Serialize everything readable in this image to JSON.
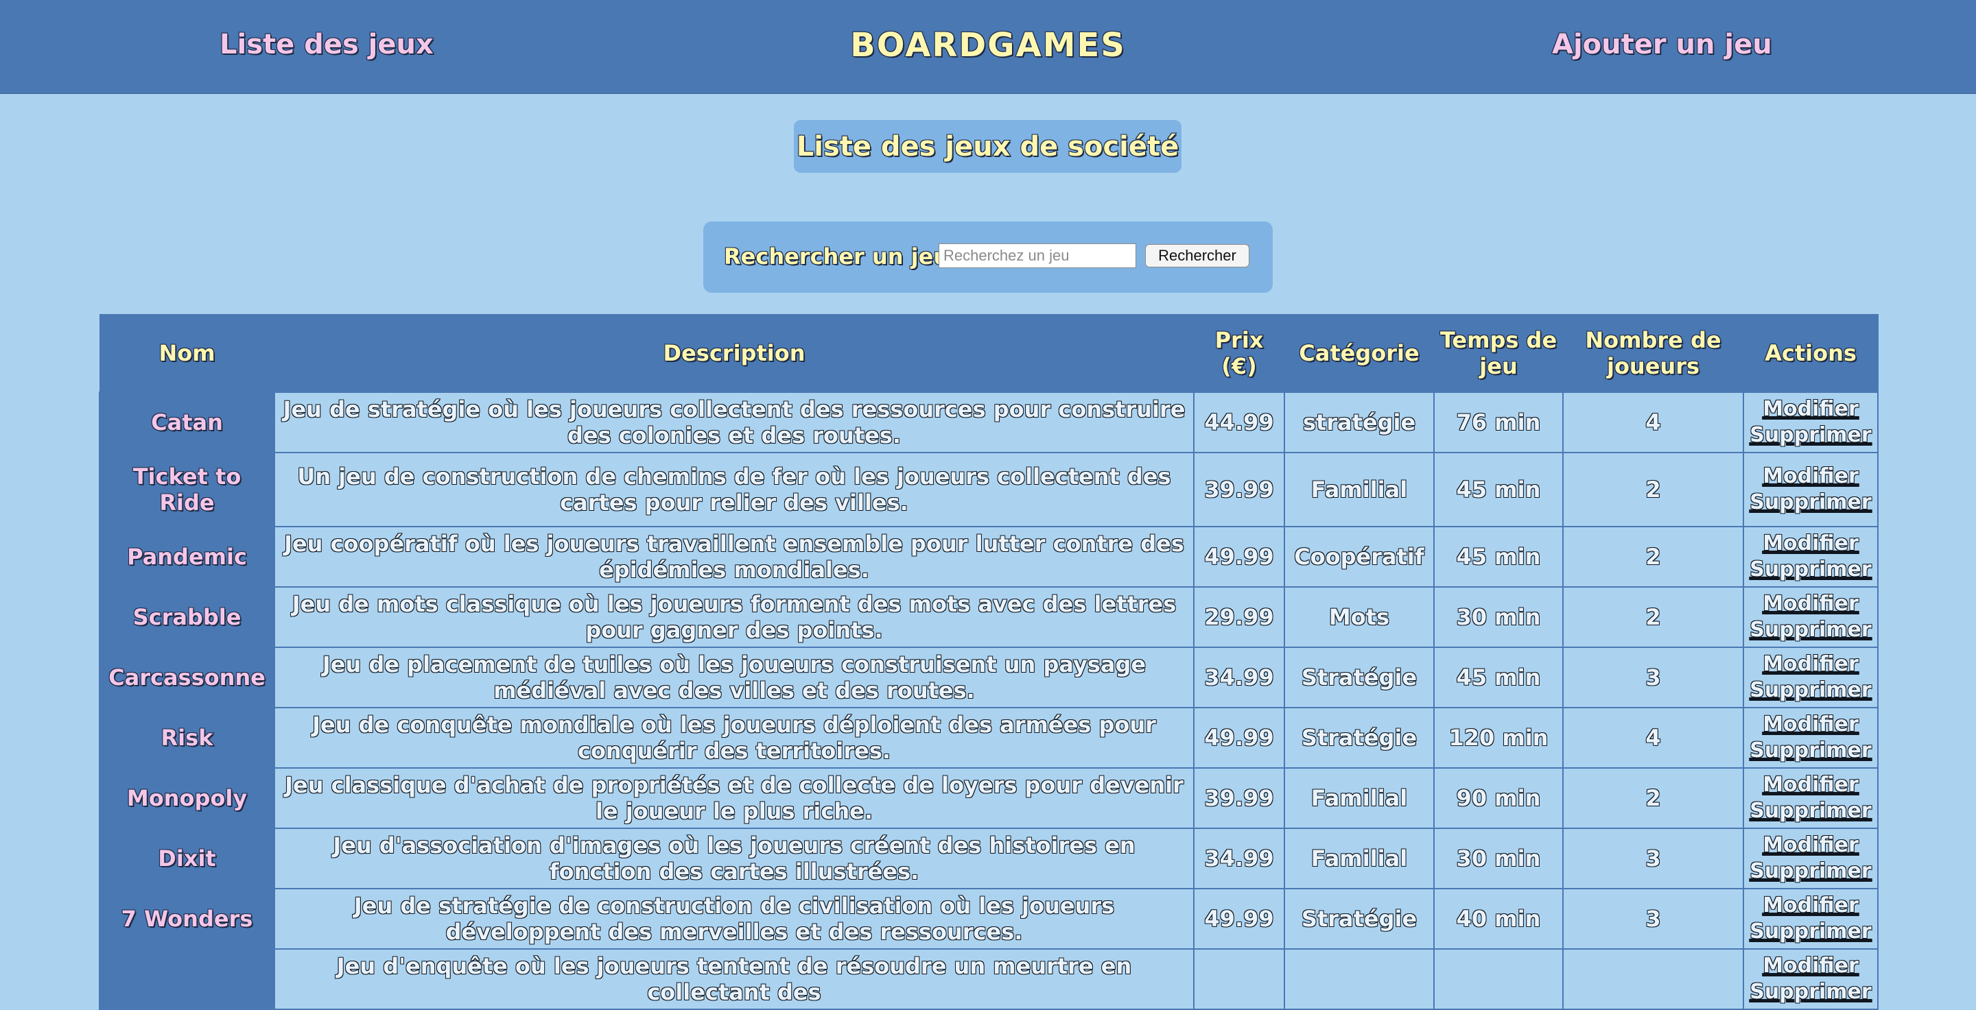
{
  "header": {
    "nav_list_label": "Liste des jeux",
    "brand": "BOARDGAMES",
    "nav_add_label": "Ajouter un jeu"
  },
  "page_title": "Liste des jeux de société",
  "search": {
    "label": "Rechercher un jeu",
    "placeholder": "Recherchez un jeu",
    "button_label": "Rechercher"
  },
  "table": {
    "headers": [
      "Nom",
      "Description",
      "Prix (€)",
      "Catégorie",
      "Temps de jeu",
      "Nombre de joueurs",
      "Actions"
    ],
    "edit_label": "Modifier",
    "delete_label": "Supprimer",
    "rows": [
      {
        "name": "Catan",
        "description": "Jeu de stratégie où les joueurs collectent des ressources pour construire des colonies et des routes.",
        "price": "44.99",
        "category": "stratégie",
        "time": "76 min",
        "players": "4"
      },
      {
        "name": "Ticket to Ride",
        "description": "Un jeu de construction de chemins de fer où les joueurs collectent des cartes pour relier des villes.",
        "price": "39.99",
        "category": "Familial",
        "time": "45 min",
        "players": "2"
      },
      {
        "name": "Pandemic",
        "description": "Jeu coopératif où les joueurs travaillent ensemble pour lutter contre des épidémies mondiales.",
        "price": "49.99",
        "category": "Coopératif",
        "time": "45 min",
        "players": "2"
      },
      {
        "name": "Scrabble",
        "description": "Jeu de mots classique où les joueurs forment des mots avec des lettres pour gagner des points.",
        "price": "29.99",
        "category": "Mots",
        "time": "30 min",
        "players": "2"
      },
      {
        "name": "Carcassonne",
        "description": "Jeu de placement de tuiles où les joueurs construisent un paysage médiéval avec des villes et des routes.",
        "price": "34.99",
        "category": "Stratégie",
        "time": "45 min",
        "players": "3"
      },
      {
        "name": "Risk",
        "description": "Jeu de conquête mondiale où les joueurs déploient des armées pour conquérir des territoires.",
        "price": "49.99",
        "category": "Stratégie",
        "time": "120 min",
        "players": "4"
      },
      {
        "name": "Monopoly",
        "description": "Jeu classique d'achat de propriétés et de collecte de loyers pour devenir le joueur le plus riche.",
        "price": "39.99",
        "category": "Familial",
        "time": "90 min",
        "players": "2"
      },
      {
        "name": "Dixit",
        "description": "Jeu d'association d'images où les joueurs créent des histoires en fonction des cartes illustrées.",
        "price": "34.99",
        "category": "Familial",
        "time": "30 min",
        "players": "3"
      },
      {
        "name": "7 Wonders",
        "description": "Jeu de stratégie de construction de civilisation où les joueurs développent des merveilles et des ressources.",
        "price": "49.99",
        "category": "Stratégie",
        "time": "40 min",
        "players": "3"
      },
      {
        "name": "",
        "description": "Jeu d'enquête où les joueurs tentent de résoudre un meurtre en collectant des",
        "price": "",
        "category": "",
        "time": "",
        "players": ""
      }
    ]
  }
}
